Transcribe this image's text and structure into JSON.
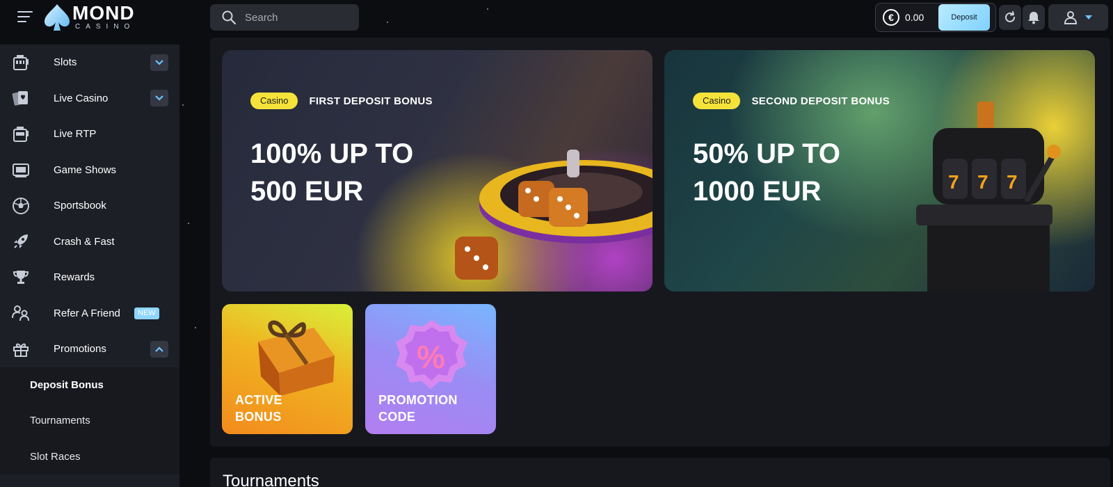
{
  "header": {
    "logo": {
      "main": "MOND",
      "sub": "CASINO"
    },
    "search": {
      "placeholder": "Search"
    },
    "wallet": {
      "currency_symbol": "€",
      "balance": "0.00",
      "deposit_label": "Deposit"
    },
    "accent": "#7fd0ff"
  },
  "sidebar": {
    "items": [
      {
        "label": "Slots",
        "icon": "slot-machine-icon",
        "chevron": "down"
      },
      {
        "label": "Live Casino",
        "icon": "cards-icon",
        "chevron": "down"
      },
      {
        "label": "Live RTP",
        "icon": "slot-machine-icon"
      },
      {
        "label": "Game Shows",
        "icon": "tv-icon"
      },
      {
        "label": "Sportsbook",
        "icon": "soccer-ball-icon"
      },
      {
        "label": "Crash & Fast",
        "icon": "rocket-icon"
      },
      {
        "label": "Rewards",
        "icon": "trophy-icon"
      },
      {
        "label": "Refer A Friend",
        "icon": "users-icon",
        "badge": "NEW"
      },
      {
        "label": "Promotions",
        "icon": "gift-icon",
        "chevron": "up"
      }
    ],
    "sub_items": [
      {
        "label": "Deposit Bonus",
        "active": true
      },
      {
        "label": "Tournaments"
      },
      {
        "label": "Slot Races"
      }
    ]
  },
  "banners": [
    {
      "tag": "Casino",
      "title": "FIRST DEPOSIT BONUS",
      "headline": "100% UP TO\n500 EUR"
    },
    {
      "tag": "Casino",
      "title": "SECOND DEPOSIT BONUS",
      "headline": "50% UP TO\n1000 EUR"
    }
  ],
  "tiles": [
    {
      "label": "ACTIVE\nBONUS"
    },
    {
      "label": "PROMOTION\nCODE"
    }
  ],
  "sections": {
    "tournaments_title": "Tournaments"
  }
}
